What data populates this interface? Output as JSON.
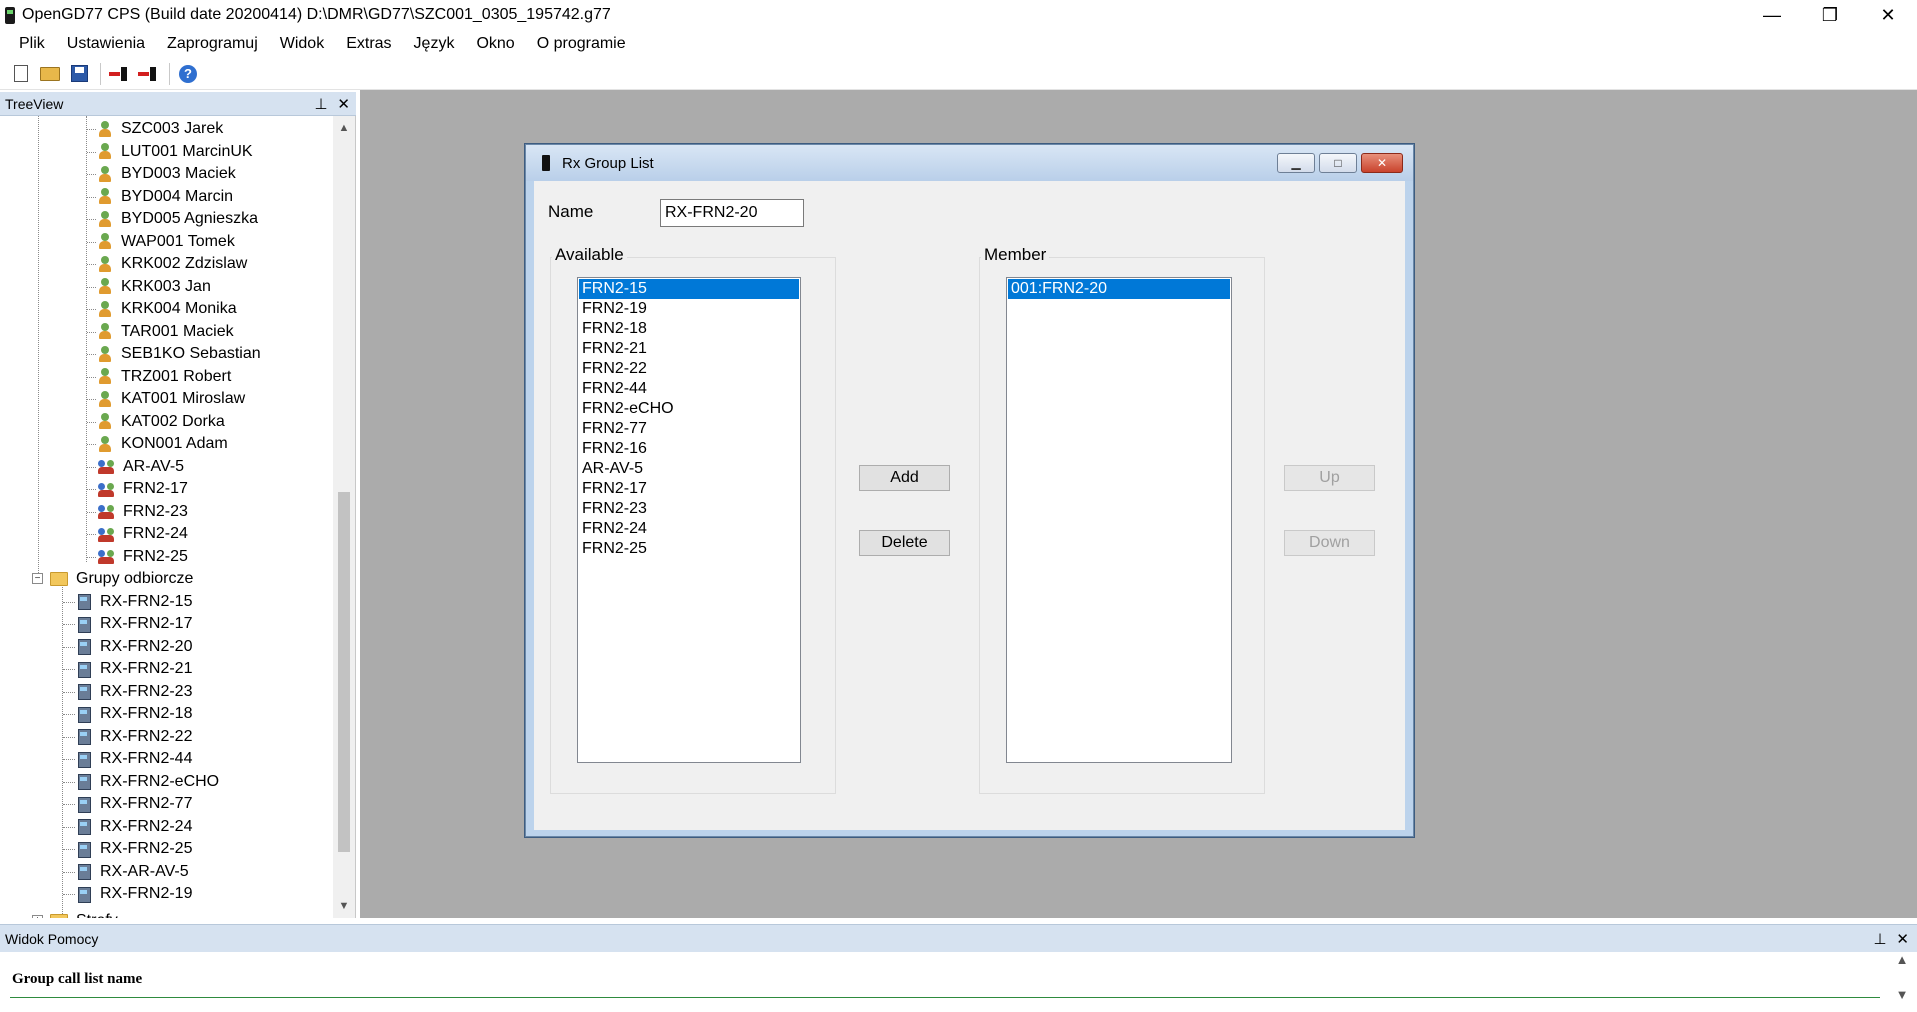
{
  "window": {
    "title": "OpenGD77 CPS (Build date 20200414) D:\\DMR\\GD77\\SZC001_0305_195742.g77",
    "minimize": "—",
    "maximize": "❐",
    "close": "✕"
  },
  "menu": [
    "Plik",
    "Ustawienia",
    "Zaprogramuj",
    "Widok",
    "Extras",
    "Język",
    "Okno",
    "O programie"
  ],
  "toolbar": {
    "icons": [
      "new-file-icon",
      "open-folder-icon",
      "save-icon",
      "read-radio-icon",
      "write-radio-icon",
      "help-icon"
    ],
    "help_glyph": "?"
  },
  "treeview": {
    "title": "TreeView",
    "pin": "⊥",
    "close": "✕",
    "contacts": [
      {
        "label": "SZC003 Jarek",
        "type": "contact"
      },
      {
        "label": "LUT001 MarcinUK",
        "type": "contact"
      },
      {
        "label": "BYD003 Maciek",
        "type": "contact"
      },
      {
        "label": "BYD004 Marcin",
        "type": "contact"
      },
      {
        "label": "BYD005 Agnieszka",
        "type": "contact"
      },
      {
        "label": "WAP001 Tomek",
        "type": "contact"
      },
      {
        "label": "KRK002 Zdzislaw",
        "type": "contact"
      },
      {
        "label": "KRK003 Jan",
        "type": "contact"
      },
      {
        "label": "KRK004 Monika",
        "type": "contact"
      },
      {
        "label": "TAR001 Maciek",
        "type": "contact"
      },
      {
        "label": "SEB1KO Sebastian",
        "type": "contact"
      },
      {
        "label": "TRZ001 Robert",
        "type": "contact"
      },
      {
        "label": "KAT001 Miroslaw",
        "type": "contact"
      },
      {
        "label": "KAT002 Dorka",
        "type": "contact"
      },
      {
        "label": "KON001 Adam",
        "type": "contact"
      },
      {
        "label": "AR-AV-5",
        "type": "group"
      },
      {
        "label": "FRN2-17",
        "type": "group"
      },
      {
        "label": "FRN2-23",
        "type": "group"
      },
      {
        "label": "FRN2-24",
        "type": "group"
      },
      {
        "label": "FRN2-25",
        "type": "group"
      }
    ],
    "folder": {
      "label": "Grupy odbiorcze",
      "expander": "−"
    },
    "rx_groups": [
      "RX-FRN2-15",
      "RX-FRN2-17",
      "RX-FRN2-20",
      "RX-FRN2-21",
      "RX-FRN2-23",
      "RX-FRN2-18",
      "RX-FRN2-22",
      "RX-FRN2-44",
      "RX-FRN2-eCHO",
      "RX-FRN2-77",
      "RX-FRN2-24",
      "RX-FRN2-25",
      "RX-AR-AV-5",
      "RX-FRN2-19"
    ],
    "next_folder": {
      "label": "Strefy",
      "expander": "+"
    },
    "scroll_up": "▲",
    "scroll_down": "▼"
  },
  "dialog": {
    "title": "Rx Group List",
    "name_label": "Name",
    "name_value": "RX-FRN2-20",
    "available_label": "Available",
    "member_label": "Member",
    "available": [
      "FRN2-15",
      "FRN2-19",
      "FRN2-18",
      "FRN2-21",
      "FRN2-22",
      "FRN2-44",
      "FRN2-eCHO",
      "FRN2-77",
      "FRN2-16",
      "AR-AV-5",
      "FRN2-17",
      "FRN2-23",
      "FRN2-24",
      "FRN2-25"
    ],
    "available_selected": 0,
    "members": [
      "001:FRN2-20"
    ],
    "members_selected": 0,
    "add_label": "Add",
    "delete_label": "Delete",
    "up_label": "Up",
    "down_label": "Down",
    "min_glyph": "▁",
    "max_glyph": "□",
    "close_glyph": "✕"
  },
  "help": {
    "title": "Widok Pomocy",
    "pin": "⊥",
    "close": "✕",
    "text": "Group call list name",
    "scroll_up": "▲",
    "scroll_down": "▼"
  }
}
